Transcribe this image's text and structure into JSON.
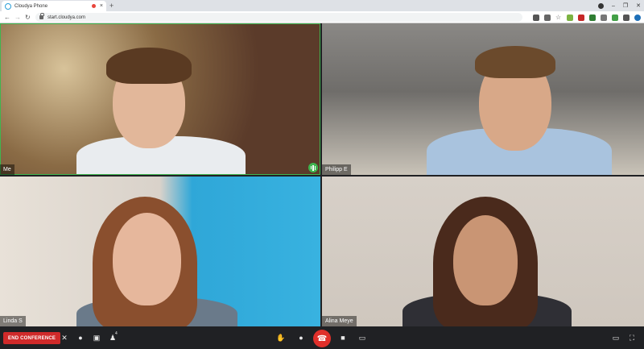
{
  "browser": {
    "tab_title": "Cloudya Phone",
    "tab_close": "×",
    "new_tab": "+",
    "url": "start.cloudya.com",
    "window_controls": {
      "minimize": "–",
      "maximize": "❐",
      "close": "✕"
    }
  },
  "participants": [
    {
      "name": "Me",
      "speaking": true
    },
    {
      "name": "Philipp E"
    },
    {
      "name": "Linda S"
    },
    {
      "name": "Alina Meye"
    }
  ],
  "controls": {
    "end_conference_label": "END CONFERENCE",
    "participant_count_badge": "4",
    "icons": [
      "mute-speaker-icon",
      "microphone-icon",
      "lock-icon",
      "add-participant-icon",
      "raise-hand-icon",
      "mic-icon",
      "hangup-icon",
      "video-icon",
      "screen-share-icon",
      "window-icon",
      "fullscreen-icon"
    ]
  },
  "colors": {
    "end_button": "#d02a2a",
    "hangup": "#e0302b",
    "speaking_indicator": "#3fb54f",
    "control_bar": "#202124"
  }
}
